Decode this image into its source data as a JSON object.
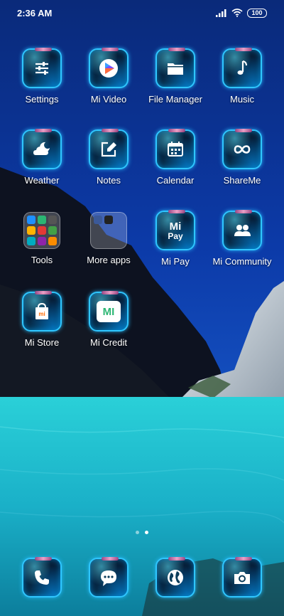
{
  "status": {
    "time": "2:36 AM",
    "battery": "100"
  },
  "apps": [
    {
      "id": "settings",
      "label": "Settings",
      "icon": "sliders-icon"
    },
    {
      "id": "mi-video",
      "label": "Mi Video",
      "icon": "play-icon"
    },
    {
      "id": "file-manager",
      "label": "File Manager",
      "icon": "folder-icon"
    },
    {
      "id": "music",
      "label": "Music",
      "icon": "music-note-icon"
    },
    {
      "id": "weather",
      "label": "Weather",
      "icon": "cloud-moon-icon"
    },
    {
      "id": "notes",
      "label": "Notes",
      "icon": "pencil-square-icon"
    },
    {
      "id": "calendar",
      "label": "Calendar",
      "icon": "calendar-icon"
    },
    {
      "id": "shareme",
      "label": "ShareMe",
      "icon": "infinity-icon"
    },
    {
      "id": "tools",
      "label": "Tools",
      "icon": "folder-grid-icon"
    },
    {
      "id": "more-apps",
      "label": "More apps",
      "icon": "folder-grid-icon"
    },
    {
      "id": "mi-pay",
      "label": "Mi Pay",
      "icon": "mi-pay-icon"
    },
    {
      "id": "mi-community",
      "label": "Mi Community",
      "icon": "people-icon"
    },
    {
      "id": "mi-store",
      "label": "Mi Store",
      "icon": "shopping-bag-icon"
    },
    {
      "id": "mi-credit",
      "label": "Mi Credit",
      "icon": "mi-credit-icon"
    }
  ],
  "mipay": {
    "line1": "Mi",
    "line2": "Pay"
  },
  "mistore": {
    "logo": "mi"
  },
  "micredit": {
    "logo": "MI"
  },
  "dock": [
    {
      "id": "phone",
      "icon": "phone-icon"
    },
    {
      "id": "messages",
      "icon": "chat-bubble-icon"
    },
    {
      "id": "browser",
      "icon": "globe-icon"
    },
    {
      "id": "camera",
      "icon": "camera-icon"
    }
  ],
  "pages": {
    "count": 2,
    "current": 2
  },
  "colors": {
    "icon_border": "#2fc6ff",
    "sky": "#0a2f8a",
    "water": "#1fb8c8"
  }
}
